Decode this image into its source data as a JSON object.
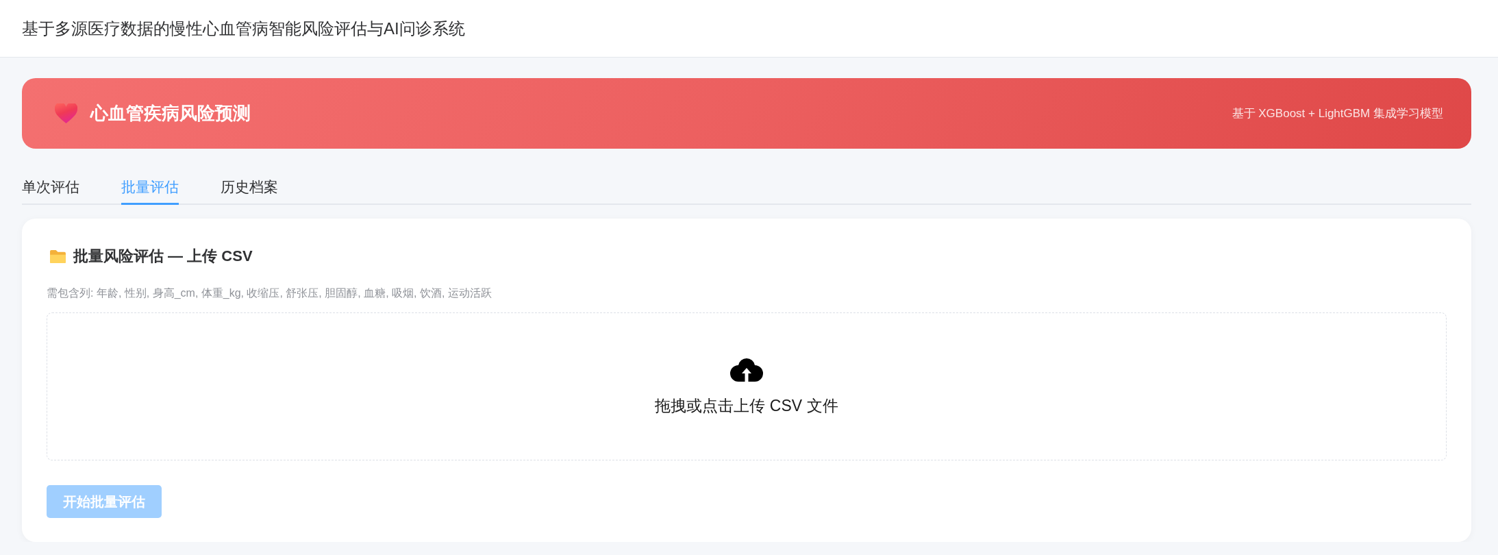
{
  "header": {
    "title": "基于多源医疗数据的慢性心血管病智能风险评估与AI问诊系统"
  },
  "banner": {
    "title": "心血管疾病风险预测",
    "subtitle": "基于 XGBoost + LightGBM 集成学习模型"
  },
  "tabs": [
    {
      "label": "单次评估",
      "selected": false
    },
    {
      "label": "批量评估",
      "selected": true
    },
    {
      "label": "历史档案",
      "selected": false
    }
  ],
  "panel": {
    "title": "批量风险评估 — 上传 CSV",
    "hint": "需包含列: 年龄, 性别, 身高_cm, 体重_kg, 收缩压, 舒张压, 胆固醇, 血糖, 吸烟, 饮酒, 运动活跃",
    "dropzone": {
      "label": "拖拽或点击上传 CSV 文件"
    },
    "button": {
      "label": "开始批量评估",
      "disabled": true
    }
  }
}
